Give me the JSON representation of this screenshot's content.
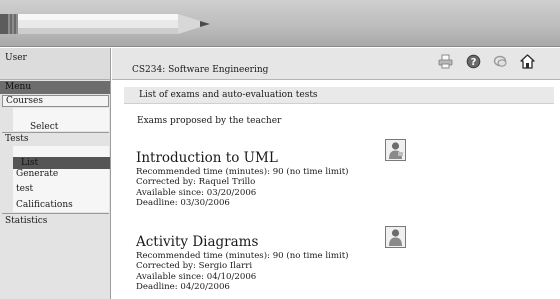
{
  "sidebar": {
    "user_label": "User",
    "menu_label": "Menu",
    "courses_label": "Courses",
    "select_label": "Select",
    "tests_label": "Tests",
    "list_label": "List",
    "generate_label_1": "Generate",
    "generate_label_2": "test",
    "califications_label": "Califications",
    "statistics_label": "Statistics"
  },
  "header": {
    "course_title": "CS234: Software Engineering"
  },
  "toolbar": {
    "icons": [
      "printer-icon",
      "help-icon",
      "settings-icon",
      "home-icon"
    ]
  },
  "content": {
    "section_title": "List of exams and auto-evaluation tests",
    "intro_text": "Exams proposed by the teacher",
    "exams": [
      {
        "name": "Introduction to UML",
        "time": "Recommended time (minutes): 90 (no time limit)",
        "corrected_by": "Corrected by: Raquel Trillo",
        "available_since": "Available since: 03/20/2006",
        "deadline": "Deadline: 03/30/2006"
      },
      {
        "name": "Activity Diagrams",
        "time": "Recommended time (minutes): 90 (no time limit)",
        "corrected_by": "Corrected by: Sergio Ilarri",
        "available_since": "Available since: 04/10/2006",
        "deadline": "Deadline: 04/20/2006"
      }
    ]
  }
}
